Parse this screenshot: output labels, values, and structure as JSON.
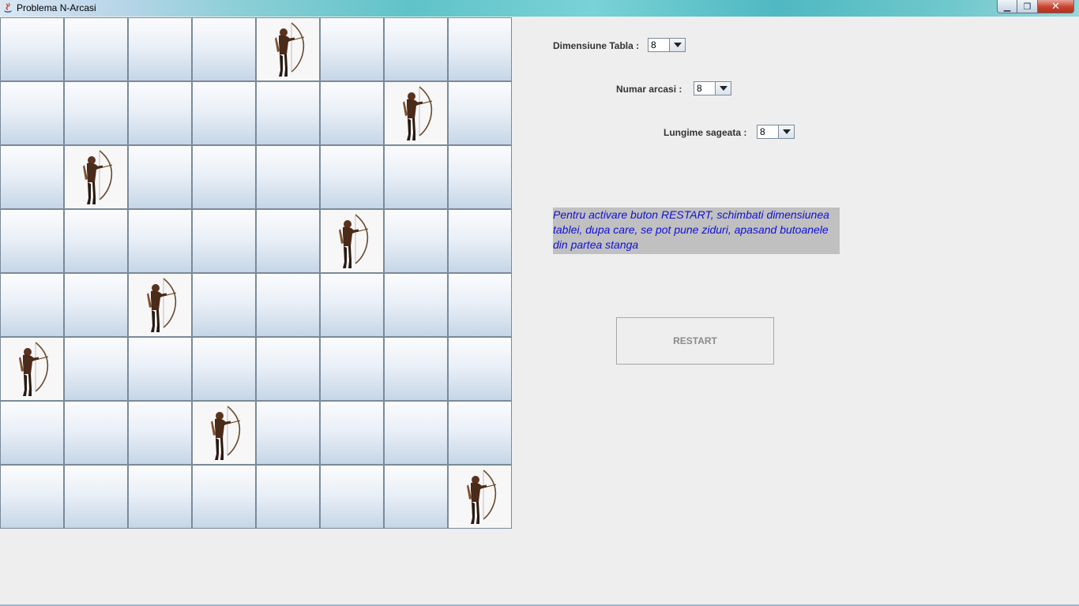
{
  "window": {
    "title": "Problema N-Arcasi",
    "minimize": "▁",
    "maximize": "❐",
    "close": "✕"
  },
  "board": {
    "size": 8,
    "archer_positions": [
      [
        0,
        4
      ],
      [
        1,
        6
      ],
      [
        2,
        1
      ],
      [
        3,
        5
      ],
      [
        4,
        2
      ],
      [
        5,
        0
      ],
      [
        6,
        3
      ],
      [
        7,
        7
      ]
    ]
  },
  "controls": {
    "board_size_label": "Dimensiune Tabla :",
    "board_size_value": "8",
    "archers_label": "Numar arcasi :",
    "archers_value": "8",
    "arrow_length_label": "Lungime sageata :",
    "arrow_length_value": "8"
  },
  "info_text": "Pentru activare buton RESTART, schimbati dimensiunea tablei, dupa care, se pot pune ziduri, apasand butoanele din partea stanga",
  "restart_label": "RESTART",
  "colors": {
    "info_text": "#1010d8",
    "info_bg": "#c0c0c0",
    "archer_cell_bg": "#f7f7f7"
  }
}
